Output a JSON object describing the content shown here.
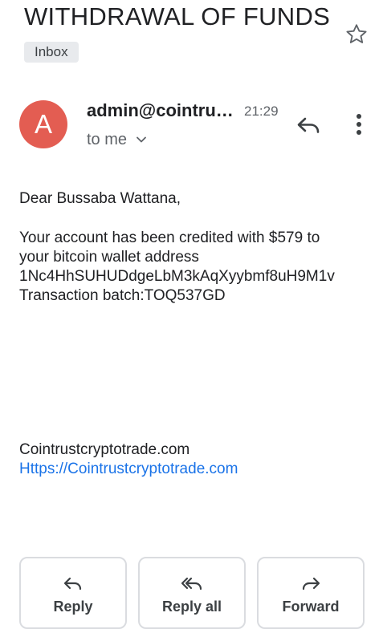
{
  "email": {
    "subject": "WITHDRAWAL OF FUNDS",
    "label": "Inbox",
    "star_icon": "star-outline-icon",
    "sender": {
      "initial": "A",
      "avatar_color": "#e35d52",
      "name": "admin@cointru…",
      "time": "21:29",
      "recipient": "to me"
    },
    "body": {
      "greeting": "Dear Bussaba Wattana,",
      "lines": [
        "Your account has been credited with $579 to",
        "your bitcoin wallet address",
        "1Nc4HhSUHUDdgeLbM3kAqXyybmf8uH9M1v",
        "Transaction batch:TOQ537GD"
      ],
      "signature": "Cointrustcryptotrade.com",
      "link": "Https://Cointrustcryptotrade.com"
    }
  },
  "actions": {
    "reply": "Reply",
    "reply_all": "Reply all",
    "forward": "Forward"
  },
  "colors": {
    "link": "#1a73e8",
    "chip_bg": "#e8eaed",
    "icon": "#5f6368"
  }
}
